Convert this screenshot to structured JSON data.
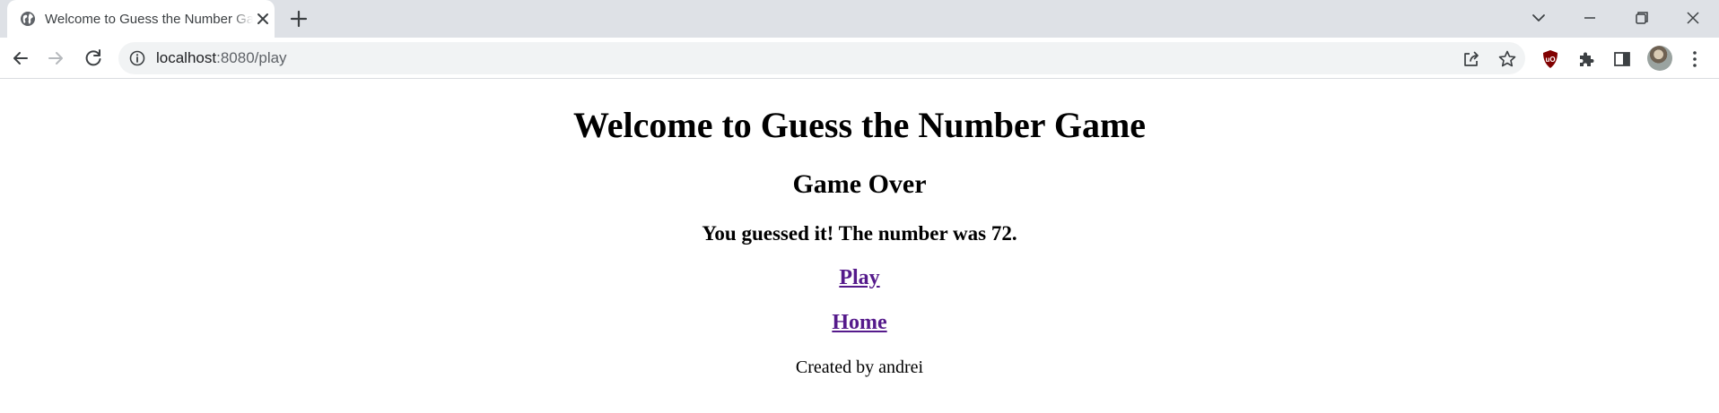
{
  "browser": {
    "tab_title": "Welcome to Guess the Number Game",
    "url_host": "localhost",
    "url_rest": ":8080/play",
    "icons": {
      "favicon": "globe-icon",
      "tab_close": "close-icon",
      "new_tab": "plus-icon",
      "tab_search": "chevron-down-icon",
      "minimize": "minimize-icon",
      "restore": "restore-icon",
      "close_window": "close-icon",
      "back": "arrow-left-icon",
      "forward": "arrow-right-icon",
      "reload": "reload-icon",
      "site_info": "info-icon",
      "share": "share-icon",
      "bookmark": "star-icon",
      "extension_ublock": "ublock-icon",
      "extensions": "puzzle-icon",
      "side_panel": "side-panel-icon",
      "profile": "avatar",
      "menu": "kebab-menu-icon"
    }
  },
  "page": {
    "heading": "Welcome to Guess the Number Game",
    "status": "Game Over",
    "result": "You guessed it! The number was 72.",
    "play_link": "Play",
    "home_link": "Home",
    "credit": "Created by andrei"
  },
  "colors": {
    "tabstrip": "#dee1e6",
    "omnibox": "#f1f3f4",
    "link_visited": "#551a8b",
    "ublock_red": "#800000"
  }
}
